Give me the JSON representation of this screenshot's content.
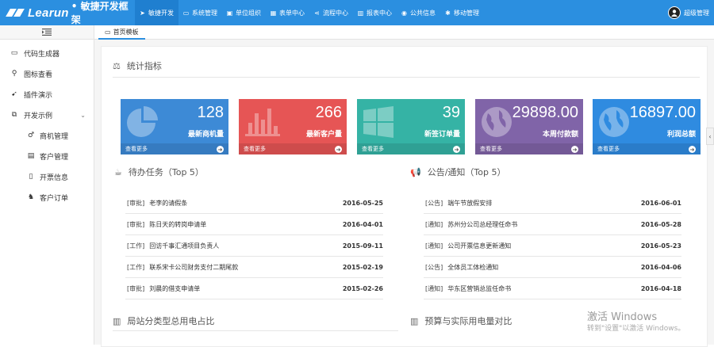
{
  "app": {
    "logo_text": "Learun",
    "logo_sub": "• 敏捷开发框架"
  },
  "nav": [
    {
      "label": "敏捷开发",
      "icon": "send-icon",
      "glyph": "➤"
    },
    {
      "label": "系统管理",
      "icon": "monitor-icon",
      "glyph": "▭"
    },
    {
      "label": "单位组织",
      "icon": "org-icon",
      "glyph": "▣"
    },
    {
      "label": "表单中心",
      "icon": "table-icon",
      "glyph": "▦"
    },
    {
      "label": "流程中心",
      "icon": "share-icon",
      "glyph": "⋖"
    },
    {
      "label": "报表中心",
      "icon": "chart-icon",
      "glyph": "▥"
    },
    {
      "label": "公共信息",
      "icon": "globe-icon",
      "glyph": "◉"
    },
    {
      "label": "移动管理",
      "icon": "android-icon",
      "glyph": "✱"
    }
  ],
  "user": {
    "name": "超级管理"
  },
  "sidebar": {
    "items": [
      {
        "label": "代码生成器",
        "glyph": "▭",
        "icon": "monitor-icon"
      },
      {
        "label": "图标查看",
        "glyph": "⚲",
        "icon": "search-icon"
      },
      {
        "label": "插件演示",
        "glyph": "➹",
        "icon": "plug-icon"
      },
      {
        "label": "开发示例",
        "glyph": "⧉",
        "icon": "clone-icon"
      }
    ],
    "subitems": [
      {
        "label": "商机管理",
        "glyph": "♂",
        "icon": "bizchance-icon"
      },
      {
        "label": "客户管理",
        "glyph": "▤",
        "icon": "id-card-icon"
      },
      {
        "label": "开票信息",
        "glyph": "▯",
        "icon": "document-icon"
      },
      {
        "label": "客户订单",
        "glyph": "♞",
        "icon": "order-icon"
      }
    ]
  },
  "tab": {
    "label": "首页模板"
  },
  "stats_title": "统计指标",
  "stats": [
    {
      "value": "128",
      "label": "最新商机量",
      "more": "查看更多",
      "color": "#3d8ad6",
      "icon": "pie-chart-icon"
    },
    {
      "value": "266",
      "label": "最新客户量",
      "more": "查看更多",
      "color": "#e65555",
      "icon": "bar-chart-icon"
    },
    {
      "value": "39",
      "label": "新签订单量",
      "more": "查看更多",
      "color": "#35b3a5",
      "icon": "windows-icon"
    },
    {
      "value": "29898.00",
      "label": "本周付款额",
      "more": "查看更多",
      "color": "#8064a8",
      "icon": "globe-icon"
    },
    {
      "value": "16897.00",
      "label": "利润总额",
      "more": "查看更多",
      "color": "#2f8be0",
      "icon": "globe-icon"
    }
  ],
  "tasks": {
    "title": "待办任务（Top 5）",
    "rows": [
      {
        "tag": "[审批]",
        "text": "老李的请假条",
        "date": "2016-05-25"
      },
      {
        "tag": "[审批]",
        "text": "陈日天的转岗申请单",
        "date": "2016-04-01"
      },
      {
        "tag": "[工作]",
        "text": "回访千事汇通项目负责人",
        "date": "2015-09-11"
      },
      {
        "tag": "[工作]",
        "text": "联系宋卡公司财务支付二期尾款",
        "date": "2015-02-19"
      },
      {
        "tag": "[审批]",
        "text": "刘晨的借支申请单",
        "date": "2015-02-26"
      }
    ]
  },
  "notices": {
    "title": "公告/通知（Top 5）",
    "rows": [
      {
        "tag": "[公告]",
        "text": "端午节放假安排",
        "date": "2016-06-01"
      },
      {
        "tag": "[通知]",
        "text": "苏州分公司总经理任命书",
        "date": "2016-05-28"
      },
      {
        "tag": "[通知]",
        "text": "公司开票信息更新通知",
        "date": "2016-05-23"
      },
      {
        "tag": "[公告]",
        "text": "全体员工体检通知",
        "date": "2016-04-06"
      },
      {
        "tag": "[通知]",
        "text": "华东区营销总监任命书",
        "date": "2016-04-18"
      }
    ]
  },
  "bottom": {
    "left_title": "局站分类型总用电占比",
    "right_title": "预算与实际用电量对比"
  },
  "watermark": {
    "line1": "激活 Windows",
    "line2": "转到\"设置\"以激活 Windows。"
  }
}
